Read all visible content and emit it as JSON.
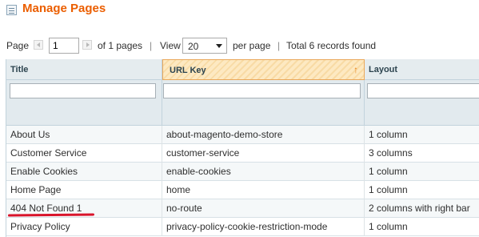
{
  "header": {
    "title": "Manage Pages"
  },
  "pager": {
    "page_label": "Page",
    "page_value": "1",
    "of_pages": "of 1 pages",
    "sep1": "|",
    "view_label": "View",
    "limit_value": "20",
    "per_page": "per page",
    "sep2": "|",
    "total": "Total 6 records found"
  },
  "grid": {
    "columns": [
      {
        "label": "Title",
        "sorted": false
      },
      {
        "label": "URL Key",
        "sorted": true,
        "sort_glyph": "↑"
      },
      {
        "label": "Layout",
        "sorted": false
      }
    ],
    "rows": [
      {
        "title": "About Us",
        "url_key": "about-magento-demo-store",
        "layout": "1 column"
      },
      {
        "title": "Customer Service",
        "url_key": "customer-service",
        "layout": "3 columns"
      },
      {
        "title": "Enable Cookies",
        "url_key": "enable-cookies",
        "layout": "1 column"
      },
      {
        "title": "Home Page",
        "url_key": "home",
        "layout": "1 column"
      },
      {
        "title": "404 Not Found 1",
        "url_key": "no-route",
        "layout": "2 columns with right bar"
      },
      {
        "title": "Privacy Policy",
        "url_key": "privacy-policy-cookie-restriction-mode",
        "layout": "1 column"
      }
    ]
  },
  "colors": {
    "accent": "#eb5e00",
    "highlight_underline": "#d9142b"
  }
}
